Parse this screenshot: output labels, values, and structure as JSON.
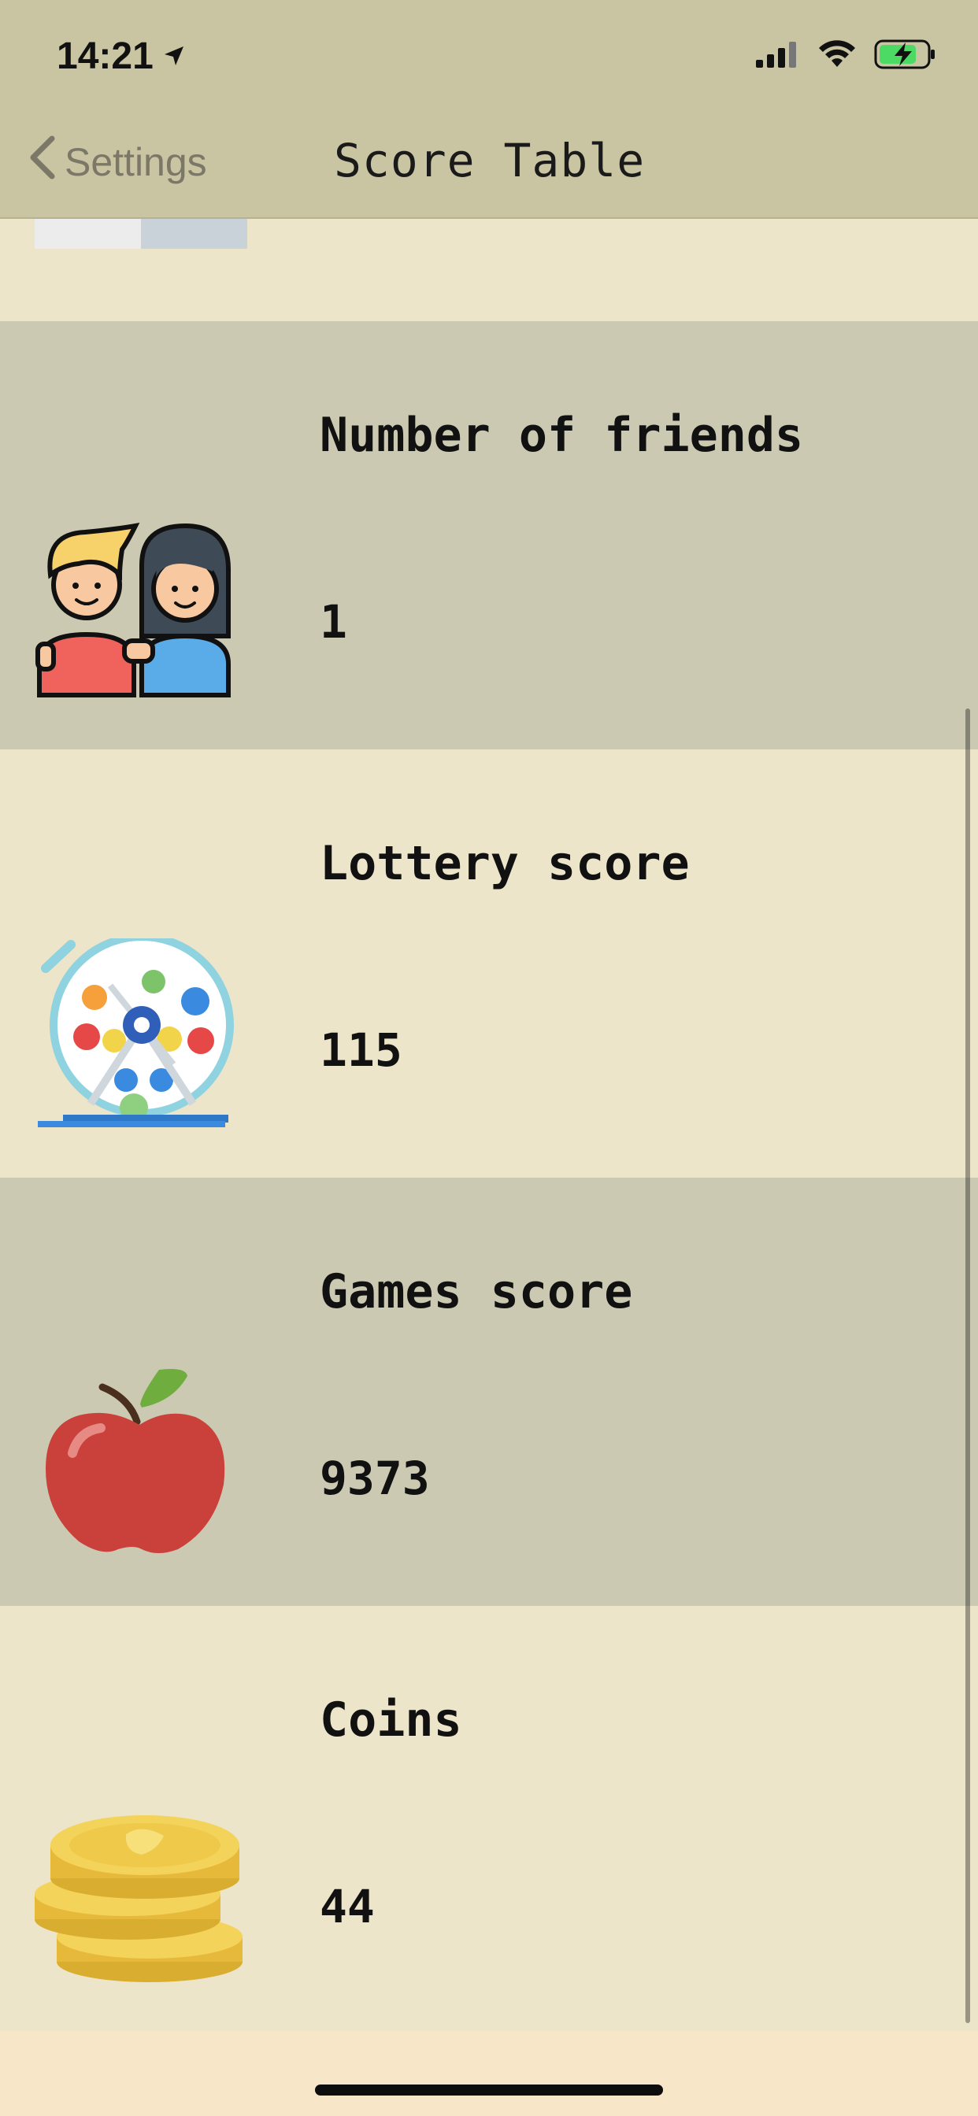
{
  "status": {
    "time": "14:21",
    "icons": [
      "location-arrow-icon",
      "cellular-signal-icon",
      "wifi-icon",
      "battery-charging-icon"
    ]
  },
  "nav": {
    "back_label": "Settings",
    "title": "Score Table"
  },
  "rows": [
    {
      "label": "Number of friends",
      "value": "1",
      "icon": "friends-icon"
    },
    {
      "label": "Lottery score",
      "value": "115",
      "icon": "lottery-machine-icon"
    },
    {
      "label": "Games score",
      "value": "9373",
      "icon": "apple-icon"
    },
    {
      "label": "Coins",
      "value": "44",
      "icon": "coins-icon"
    }
  ],
  "colors": {
    "nav_background": "#c9c4a1",
    "row_light": "#ede5c9",
    "row_dark": "#ccc9b3",
    "back_text": "#7b7868"
  }
}
